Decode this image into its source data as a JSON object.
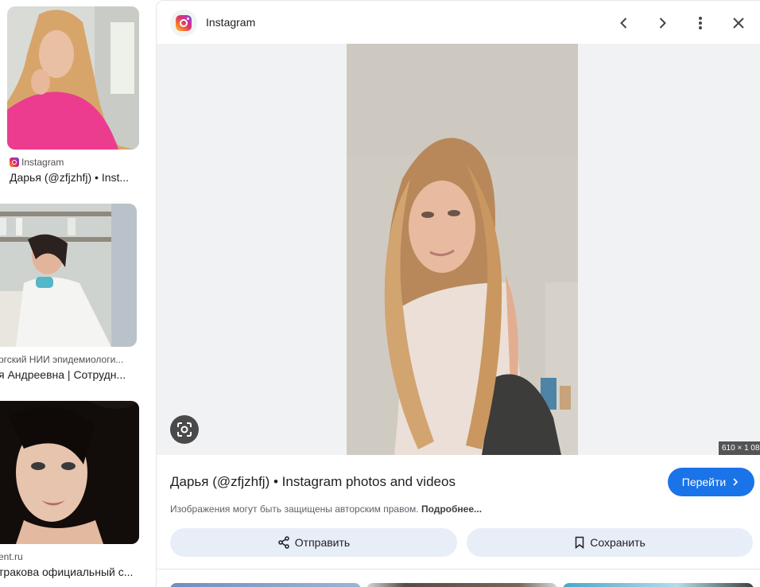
{
  "results": [
    {
      "source": "Instagram",
      "title": "Дарья (@zfjzhfj) • Inst...",
      "has_source_icon": true
    },
    {
      "source": "ргский НИИ эпидемиологи...",
      "title": "я Андреевна | Сотрудн..."
    },
    {
      "source": "ent.ru",
      "title": "тракова официальный с..."
    }
  ],
  "preview": {
    "site_name": "Instagram",
    "site_icon": "instagram-logo-icon",
    "header_buttons": [
      "chevron-left-icon",
      "chevron-right-icon",
      "more-vert-icon",
      "close-icon"
    ],
    "dimensions": "610 × 1 08",
    "title": "Дарья (@zfjzhfj) • Instagram photos and videos",
    "visit_label": "Перейти",
    "copyright_text": "Изображения могут быть защищены авторским правом.",
    "copyright_link": "Подробнее...",
    "share_label": "Отправить",
    "save_label": "Сохранить"
  },
  "colors": {
    "accent": "#1a73e8",
    "action_bg": "#e8eef8",
    "stage_bg": "#f0f2f3"
  }
}
